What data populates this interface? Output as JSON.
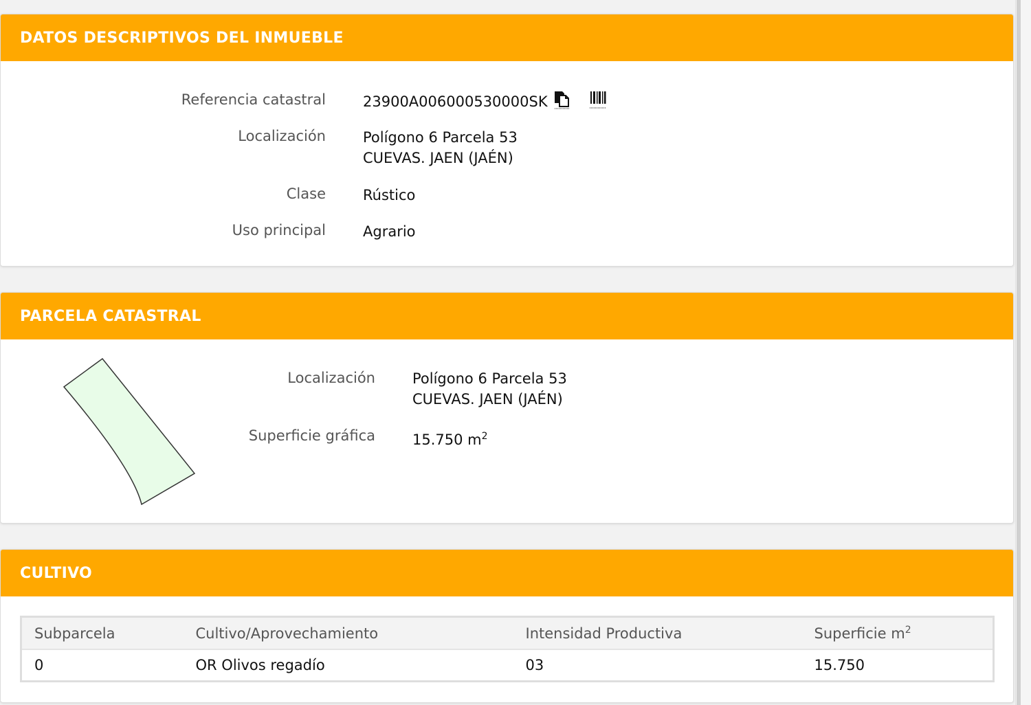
{
  "datos": {
    "header": "DATOS DESCRIPTIVOS DEL INMUEBLE",
    "ref_label": "Referencia catastral",
    "ref_value": "23900A006000530000SK",
    "loc_label": "Localización",
    "loc_line1": "Polígono 6 Parcela 53",
    "loc_line2": "CUEVAS. JAEN (JAÉN)",
    "clase_label": "Clase",
    "clase_value": "Rústico",
    "uso_label": "Uso principal",
    "uso_value": "Agrario"
  },
  "parcela": {
    "header": "PARCELA CATASTRAL",
    "loc_label": "Localización",
    "loc_line1": "Polígono 6 Parcela 53",
    "loc_line2": "CUEVAS. JAEN (JAÉN)",
    "sup_label": "Superficie gráfica",
    "sup_value": "15.750 m",
    "sup_exp": "2"
  },
  "cultivo": {
    "header": "CULTIVO",
    "col_subparcela": "Subparcela",
    "col_cultivo": "Cultivo/Aprovechamiento",
    "col_intensidad": "Intensidad Productiva",
    "col_superficie": "Superficie m",
    "col_superficie_exp": "2",
    "row": {
      "subparcela": "0",
      "cultivo": "OR Olivos regadío",
      "intensidad": "03",
      "superficie": "15.750"
    }
  },
  "colors": {
    "header_bg": "#ffa800",
    "parcel_fill": "#e8fce8",
    "parcel_stroke": "#333333"
  },
  "icons": [
    "copy-icon",
    "barcode-icon"
  ]
}
